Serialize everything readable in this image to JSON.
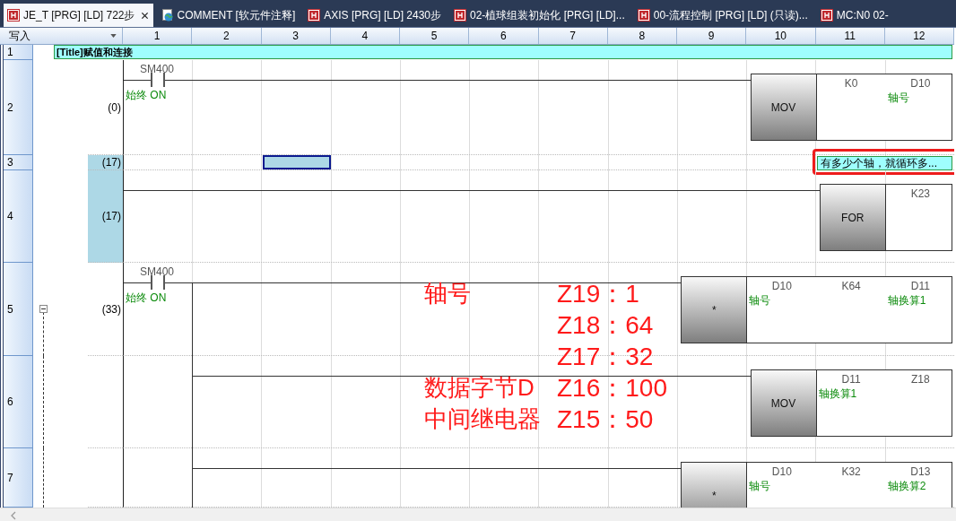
{
  "tabs": [
    {
      "label": "JE_T [PRG] [LD] 722步",
      "kind": "ladder",
      "selected": true
    },
    {
      "label": "COMMENT [软元件注释]",
      "kind": "comment",
      "selected": false
    },
    {
      "label": "AXIS [PRG] [LD] 2430步",
      "kind": "ladder",
      "selected": false
    },
    {
      "label": "02-植球组装初始化 [PRG] [LD]...",
      "kind": "ladder",
      "selected": false
    },
    {
      "label": "00-流程控制 [PRG] [LD] (只读)...",
      "kind": "ladder",
      "selected": false
    },
    {
      "label": "MC:N0 02-",
      "kind": "ladder",
      "selected": false
    }
  ],
  "header": {
    "mode": "写入",
    "columns": [
      "1",
      "2",
      "3",
      "4",
      "5",
      "6",
      "7",
      "8",
      "9",
      "10",
      "11",
      "12"
    ]
  },
  "rows": [
    {
      "number": "1",
      "kind": "title",
      "text": "[Title]赋值和连接"
    },
    {
      "number": "2",
      "kind": "rung",
      "step": "(0)",
      "selected": false,
      "contact": {
        "device": "SM400",
        "comment": "始终 ON"
      },
      "instruction": {
        "name": "MOV",
        "operands": [
          {
            "device": "K0"
          },
          {
            "device": "D10",
            "comment": "轴号"
          }
        ]
      }
    },
    {
      "number": "3",
      "kind": "statement",
      "step": "(17)",
      "text": "有多少个轴，就循环多...",
      "marked": true,
      "selected": true,
      "cursor": true
    },
    {
      "number": "4",
      "kind": "rung",
      "step": "(17)",
      "selected": true,
      "instruction": {
        "name": "FOR",
        "operands": [
          {
            "device": "K23"
          }
        ]
      }
    },
    {
      "number": "5",
      "kind": "rung",
      "step": "(33)",
      "selected": false,
      "collapsible": true,
      "contact": {
        "device": "SM400",
        "comment": "始终 ON"
      },
      "instruction": {
        "name": "*",
        "operands": [
          {
            "device": "D10",
            "comment": "轴号"
          },
          {
            "device": "K64"
          },
          {
            "device": "D11",
            "comment": "轴换算1"
          }
        ]
      }
    },
    {
      "number": "6",
      "kind": "branch",
      "instruction": {
        "name": "MOV",
        "operands": [
          {
            "device": "D11",
            "comment": "轴换算1"
          },
          {
            "device": "Z18"
          }
        ]
      }
    },
    {
      "number": "7",
      "kind": "branch",
      "instruction": {
        "name": "*",
        "operands": [
          {
            "device": "D10",
            "comment": "轴号"
          },
          {
            "device": "K32"
          },
          {
            "device": "D13",
            "comment": "轴换算2"
          }
        ]
      }
    }
  ],
  "annotations": [
    {
      "label": "轴号",
      "value": "Z19：1"
    },
    {
      "value": "Z18：64"
    },
    {
      "value": "Z17：32"
    },
    {
      "label": "数据字节D",
      "value": "Z16：100"
    },
    {
      "label": "中间继电器",
      "value": "Z15：50"
    }
  ]
}
